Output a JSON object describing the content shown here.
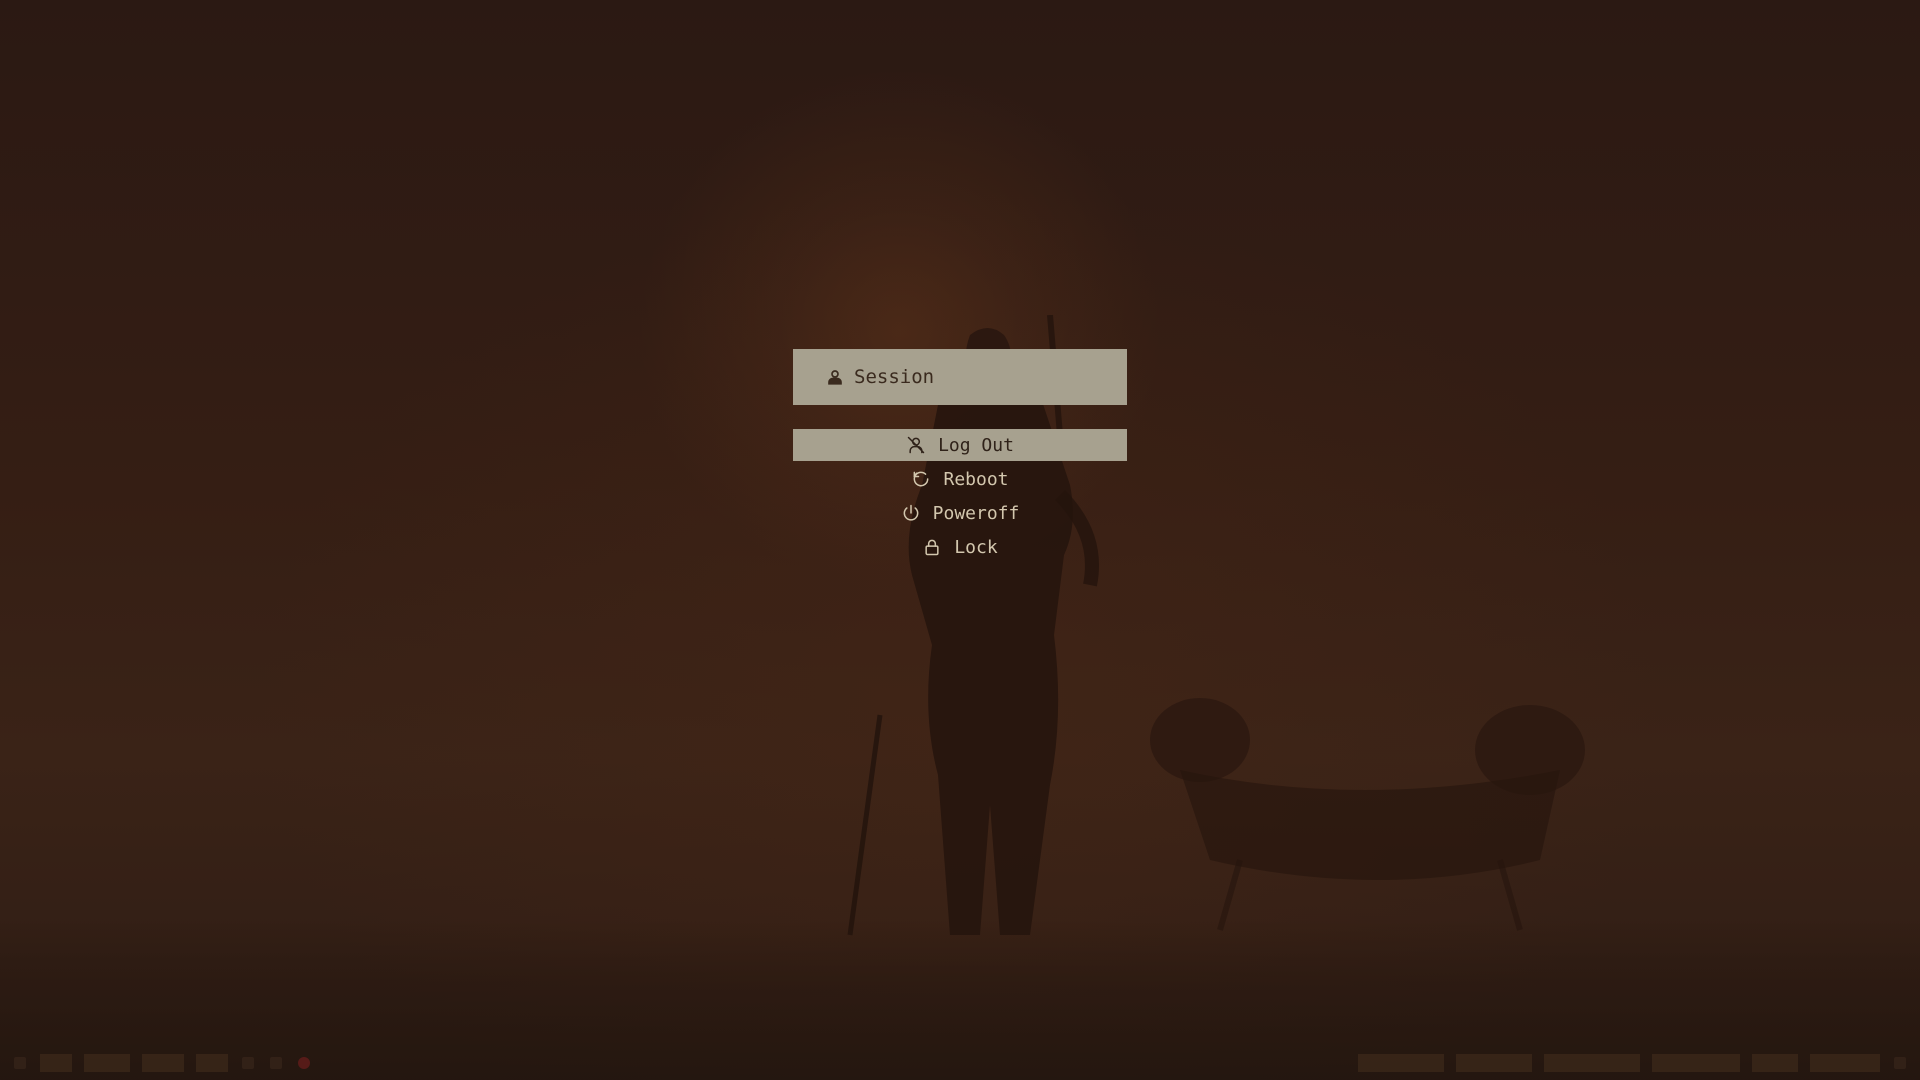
{
  "prompt": {
    "label": "Session",
    "icon": "user-icon"
  },
  "menu_items": [
    {
      "label": "Log Out",
      "icon": "user-off-icon",
      "selected": true
    },
    {
      "label": "Reboot",
      "icon": "refresh-icon",
      "selected": false
    },
    {
      "label": "Poweroff",
      "icon": "power-icon",
      "selected": false
    },
    {
      "label": "Lock",
      "icon": "lock-icon",
      "selected": false
    }
  ],
  "colors": {
    "highlight": "#a7a18f",
    "item_text": "#d3c7ae",
    "background": "#2a1a12"
  }
}
